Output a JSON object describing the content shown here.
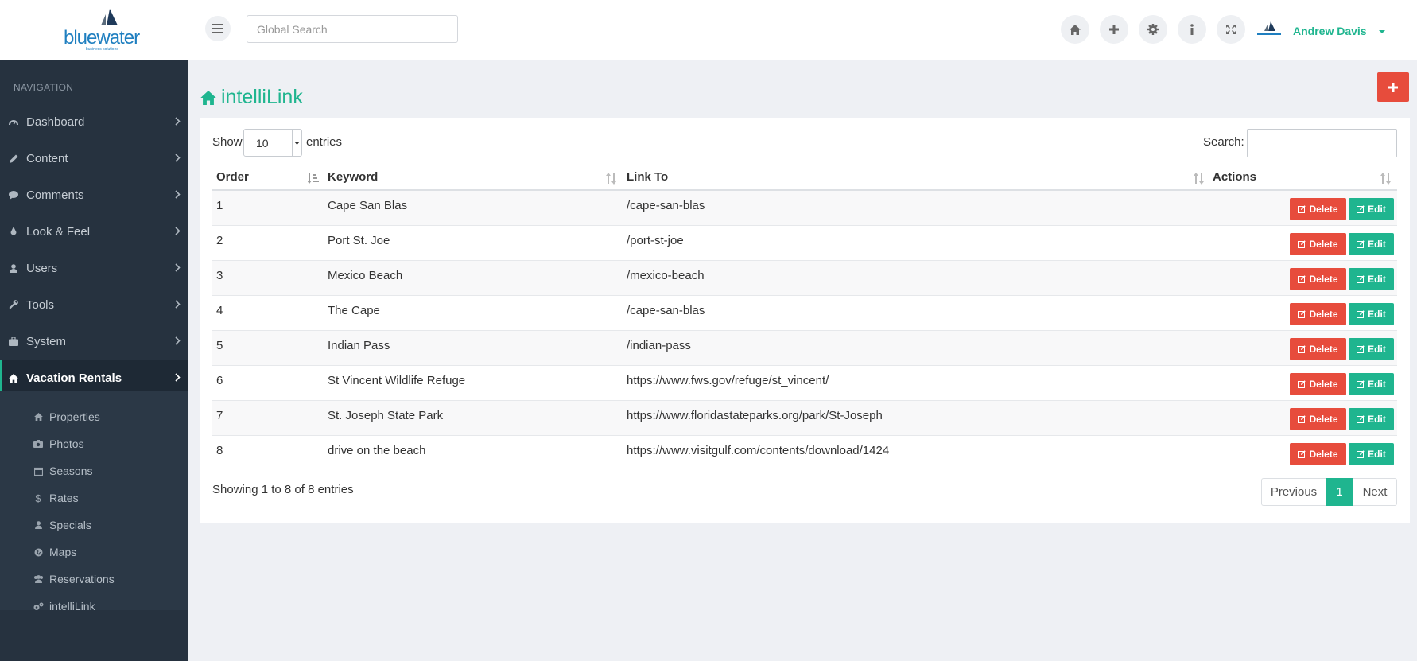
{
  "brand": {
    "logo_text": "bluewater",
    "logo_tagline": "business solutions"
  },
  "header": {
    "search_placeholder": "Global Search",
    "user_name": "Andrew Davis",
    "icons": [
      "menu-icon",
      "home-icon",
      "plus-icon",
      "gear-icon",
      "info-icon",
      "expand-icon"
    ]
  },
  "sidebar": {
    "heading": "NAVIGATION",
    "items": [
      {
        "label": "Dashboard",
        "icon": "dashboard-icon"
      },
      {
        "label": "Content",
        "icon": "pencil-icon"
      },
      {
        "label": "Comments",
        "icon": "comment-icon"
      },
      {
        "label": "Look & Feel",
        "icon": "tint-icon"
      },
      {
        "label": "Users",
        "icon": "user-icon"
      },
      {
        "label": "Tools",
        "icon": "wrench-icon"
      },
      {
        "label": "System",
        "icon": "briefcase-icon"
      },
      {
        "label": "Vacation Rentals",
        "icon": "home-icon",
        "active": true
      }
    ],
    "subitems": [
      {
        "label": "Properties",
        "icon": "home-icon"
      },
      {
        "label": "Photos",
        "icon": "camera-icon"
      },
      {
        "label": "Seasons",
        "icon": "calendar-icon"
      },
      {
        "label": "Rates",
        "icon": "dollar-icon"
      },
      {
        "label": "Specials",
        "icon": "user-icon"
      },
      {
        "label": "Maps",
        "icon": "globe-icon"
      },
      {
        "label": "Reservations",
        "icon": "users-icon"
      },
      {
        "label": "intelliLink",
        "icon": "cogs-icon"
      }
    ]
  },
  "page": {
    "title": "intelliLink",
    "add_button_icon": "plus-icon"
  },
  "table": {
    "show_label": "Show",
    "length_value": "10",
    "entries_label": "entries",
    "search_label": "Search:",
    "columns": [
      "Order",
      "Keyword",
      "Link To",
      "Actions"
    ],
    "rows": [
      {
        "order": "1",
        "keyword": "Cape San Blas",
        "link": "/cape-san-blas"
      },
      {
        "order": "2",
        "keyword": "Port St. Joe",
        "link": "/port-st-joe"
      },
      {
        "order": "3",
        "keyword": "Mexico Beach",
        "link": "/mexico-beach"
      },
      {
        "order": "4",
        "keyword": "The Cape",
        "link": "/cape-san-blas"
      },
      {
        "order": "5",
        "keyword": "Indian Pass",
        "link": "/indian-pass"
      },
      {
        "order": "6",
        "keyword": "St Vincent Wildlife Refuge",
        "link": "https://www.fws.gov/refuge/st_vincent/"
      },
      {
        "order": "7",
        "keyword": "St. Joseph State Park",
        "link": "https://www.floridastateparks.org/park/St-Joseph"
      },
      {
        "order": "8",
        "keyword": "drive on the beach",
        "link": "https://www.visitgulf.com/contents/download/1424"
      }
    ],
    "delete_label": "Delete",
    "edit_label": "Edit",
    "info": "Showing 1 to 8 of 8 entries",
    "pagination": {
      "previous": "Previous",
      "current": "1",
      "next": "Next"
    }
  },
  "colors": {
    "accent": "#1fb58f",
    "danger": "#e74c3c",
    "sidebar": "#26323f"
  }
}
